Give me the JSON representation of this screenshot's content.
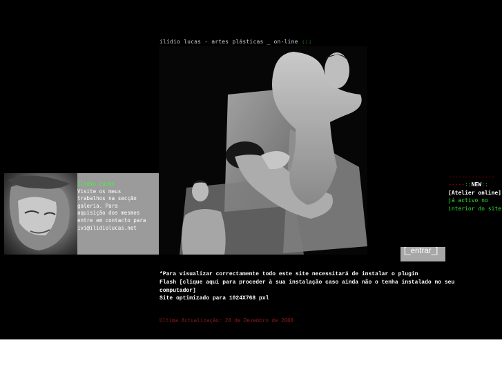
{
  "header": {
    "title": "ilídio lucas - artes plásticas _ on-line",
    "dots": ":::"
  },
  "promo": {
    "title": "Ilídio Lucas",
    "lines": [
      "Visite os meus",
      "trabalhos na secção",
      "galeria. Para",
      "aquisição dos mesmos",
      "entre em contacto para",
      "ivi@ilidiolucas.net"
    ]
  },
  "news": {
    "dashes1": "--------------",
    "dashes2": "-----",
    "dots1": "::",
    "new_label": "NEW",
    "dots2": "::",
    "item_bold": "[Atelier online]",
    "item_rest": "já activo no interior do site"
  },
  "enter_button": {
    "label": "[_entrar_]"
  },
  "notes": {
    "line1": "*Para visualizar correctamente todo este site necessitará de instalar o plugin",
    "link": "Flash [clique aqui para proceder à sua instalação caso ainda não o tenha instalado no seu computador]",
    "line3": "Site optimizado para 1024X768 pxl"
  },
  "footer": {
    "update": "Última Actualização: 28 de Dezembro de 2008"
  },
  "colors": {
    "background": "#000000",
    "accent_green": "#2ee82e",
    "accent_red": "#d60000",
    "panel_gray": "#9b9b9b"
  }
}
